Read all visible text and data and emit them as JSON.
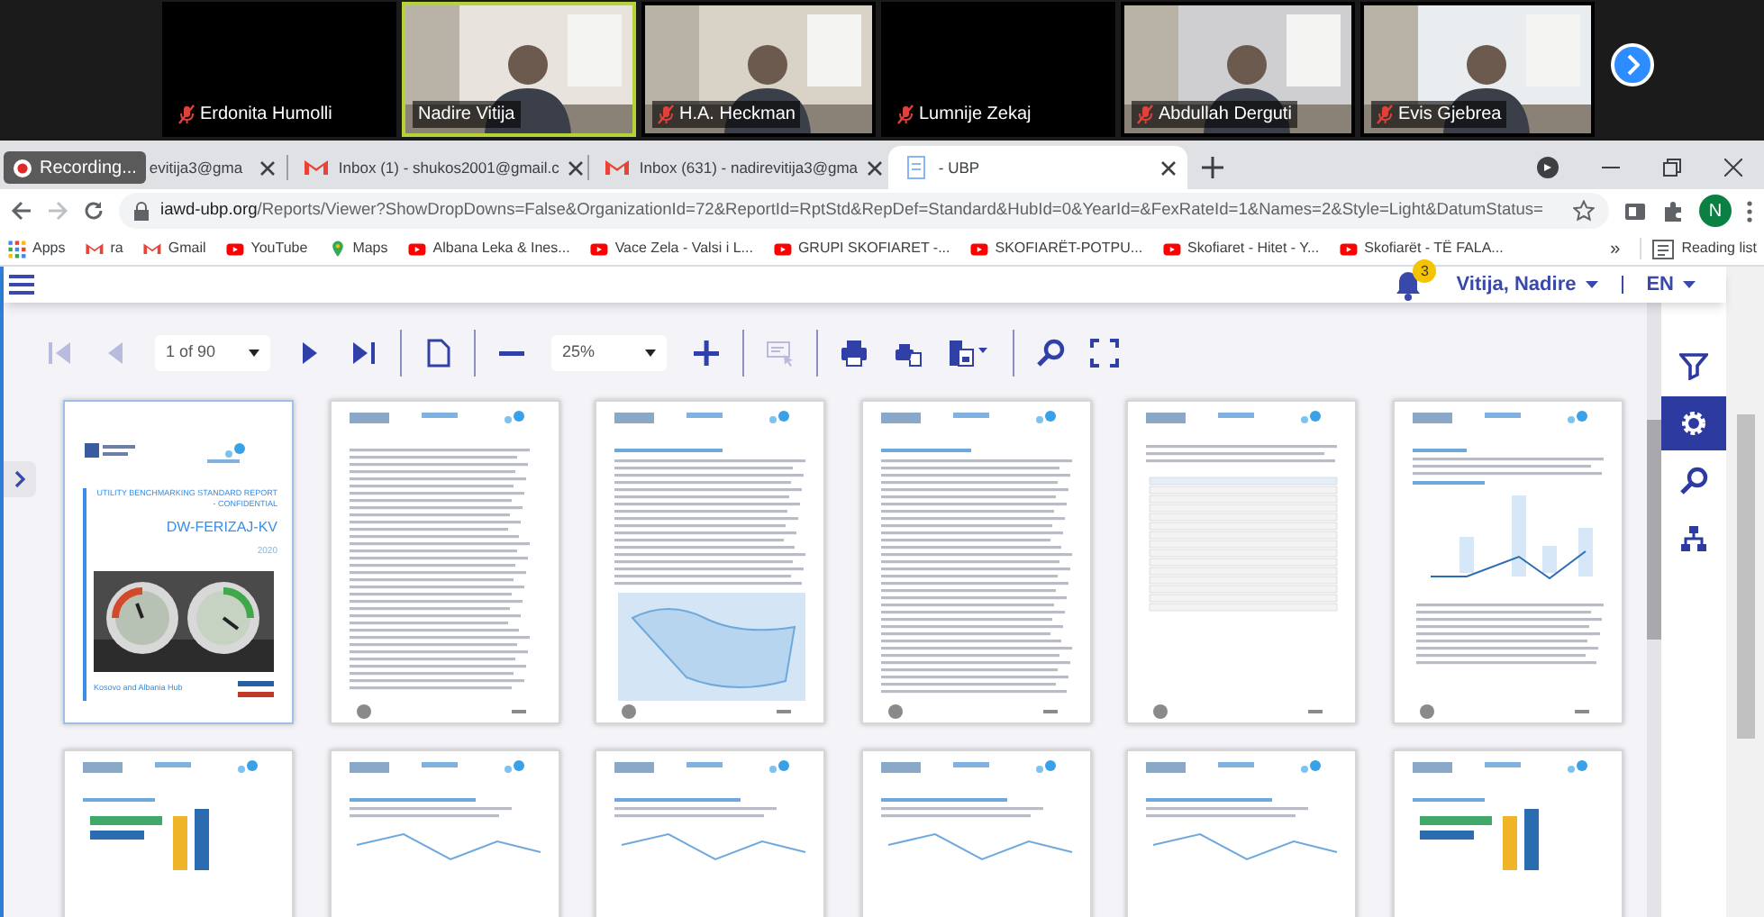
{
  "meeting": {
    "participants": [
      {
        "name": "Erdonita Humolli",
        "muted": true,
        "video": false,
        "speaking": false
      },
      {
        "name": "Nadire Vitija",
        "muted": false,
        "video": true,
        "speaking": true
      },
      {
        "name": "H.A. Heckman",
        "muted": true,
        "video": true,
        "speaking": false
      },
      {
        "name": "Lumnije Zekaj",
        "muted": true,
        "video": false,
        "speaking": false
      },
      {
        "name": "Abdullah Derguti",
        "muted": true,
        "video": true,
        "speaking": false
      },
      {
        "name": "Evis Gjebrea",
        "muted": true,
        "video": true,
        "speaking": false
      }
    ]
  },
  "recording": "Recording...",
  "browser": {
    "tabs": [
      {
        "title": "evitija3@gma",
        "kind": "hidden",
        "selected": false
      },
      {
        "title": "Inbox (1) - shukos2001@gmail.c",
        "kind": "mail",
        "selected": false
      },
      {
        "title": "Inbox (631) - nadirevitija3@gma",
        "kind": "mail",
        "selected": false
      },
      {
        "title": "- UBP",
        "kind": "page",
        "selected": true
      }
    ],
    "url_host": "iawd-ubp.org",
    "url_path": "/Reports/Viewer?ShowDropDowns=False&OrganizationId=72&ReportId=RptStd&RepDef=Standard&HubId=0&YearId=&FexRateId=1&Names=2&Style=Light&DatumStatus=",
    "profile": "N",
    "bookmarks": [
      {
        "label": "Apps",
        "kind": "apps"
      },
      {
        "label": "ra",
        "kind": "mail"
      },
      {
        "label": "Gmail",
        "kind": "mail"
      },
      {
        "label": "YouTube",
        "kind": "video"
      },
      {
        "label": "Maps",
        "kind": "map"
      },
      {
        "label": "Albana Leka & Ines...",
        "kind": "video"
      },
      {
        "label": "Vace Zela - Valsi i L...",
        "kind": "video"
      },
      {
        "label": "GRUPI SKOFIARET -...",
        "kind": "video"
      },
      {
        "label": "SKOFIARËT-POTPU...",
        "kind": "video"
      },
      {
        "label": "Skofiaret - Hitet - Y...",
        "kind": "video"
      },
      {
        "label": "Skofiarët - TË FALA...",
        "kind": "video"
      }
    ],
    "more": "»",
    "reading_list": "Reading list"
  },
  "app": {
    "notifications": "3",
    "user": "Vitija, Nadire",
    "language": "EN"
  },
  "viewer": {
    "tools": [
      {
        "kind": "first",
        "disabled": true
      },
      {
        "kind": "prev",
        "disabled": true
      },
      {
        "kind": "page-select",
        "value": "1 of 90"
      },
      {
        "kind": "next",
        "disabled": false
      },
      {
        "kind": "last",
        "disabled": false
      },
      {
        "kind": "sep"
      },
      {
        "kind": "page-view",
        "disabled": false
      },
      {
        "kind": "sep"
      },
      {
        "kind": "zoom-out",
        "disabled": false
      },
      {
        "kind": "zoom-select",
        "value": "25%"
      },
      {
        "kind": "zoom-in",
        "disabled": false
      },
      {
        "kind": "sep"
      },
      {
        "kind": "select-tool",
        "disabled": true
      },
      {
        "kind": "sep"
      },
      {
        "kind": "print",
        "disabled": false
      },
      {
        "kind": "print-layout",
        "disabled": false
      },
      {
        "kind": "export",
        "disabled": false
      },
      {
        "kind": "sep"
      },
      {
        "kind": "search",
        "disabled": false
      },
      {
        "kind": "fullscreen",
        "disabled": false
      }
    ],
    "side_tools": [
      {
        "kind": "filter",
        "selected": false
      },
      {
        "kind": "settings",
        "selected": true
      },
      {
        "kind": "search",
        "selected": false
      },
      {
        "kind": "hierarchy",
        "selected": false
      }
    ],
    "pages": [
      {
        "kind": "cover",
        "selected": true,
        "title": "UTILITY BENCHMARKING STANDARD REPORT - CONFIDENTIAL",
        "utility": "DW-FERIZAJ-KV",
        "year": "2020",
        "hub": "Kosovo and Albania Hub"
      },
      {
        "kind": "toc",
        "selected": false
      },
      {
        "kind": "map",
        "selected": false
      },
      {
        "kind": "text",
        "selected": false
      },
      {
        "kind": "table",
        "selected": false
      },
      {
        "kind": "chart",
        "selected": false
      },
      {
        "kind": "bars",
        "selected": false
      },
      {
        "kind": "line",
        "selected": false
      },
      {
        "kind": "line",
        "selected": false
      },
      {
        "kind": "line",
        "selected": false
      },
      {
        "kind": "line",
        "selected": false
      },
      {
        "kind": "bars",
        "selected": false
      }
    ]
  }
}
